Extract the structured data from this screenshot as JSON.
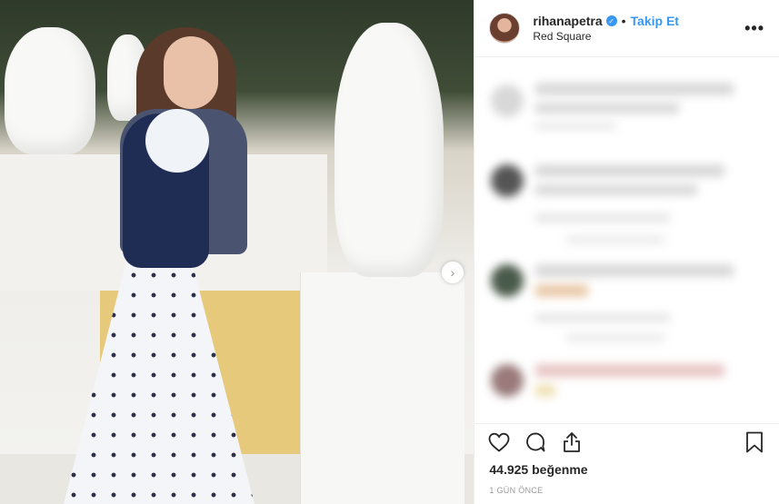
{
  "header": {
    "username": "rihanapetra",
    "separator": "•",
    "follow_label": "Takip Et",
    "location": "Red Square",
    "more_glyph": "•••"
  },
  "media": {
    "next_glyph": "›"
  },
  "actions": {
    "icons": [
      "heart-icon",
      "comment-icon",
      "share-icon",
      "bookmark-icon"
    ]
  },
  "stats": {
    "likes": "44.925 beğenme",
    "time": "1 GÜN ÖNCE"
  },
  "colors": {
    "accent": "#3897f0",
    "text": "#262626",
    "muted": "#999999"
  }
}
